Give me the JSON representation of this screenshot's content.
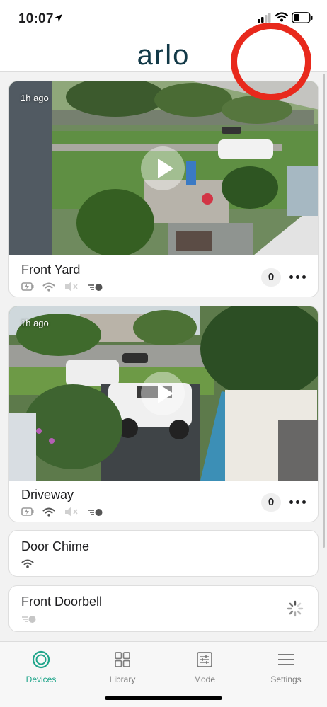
{
  "status_bar": {
    "time": "10:07",
    "location_icon": "location-arrow-icon",
    "signal_icon": "cellular-signal-icon",
    "wifi_icon": "wifi-icon",
    "battery_icon": "battery-icon"
  },
  "header": {
    "brand": "arlo",
    "brand_color": "#123947"
  },
  "annotation": {
    "color": "#e8291c"
  },
  "devices": [
    {
      "name": "Front Yard",
      "time_ago": "1h ago",
      "count": "0",
      "icons": [
        "battery-charging-icon",
        "wifi-icon",
        "speaker-muted-icon",
        "motion-toggle-icon"
      ]
    },
    {
      "name": "Driveway",
      "time_ago": "1h ago",
      "count": "0",
      "icons": [
        "battery-charging-icon",
        "wifi-icon",
        "speaker-muted-icon",
        "motion-toggle-icon"
      ]
    },
    {
      "name": "Door Chime",
      "icons": [
        "wifi-icon"
      ]
    },
    {
      "name": "Front Doorbell",
      "icons": [
        "motion-toggle-icon",
        "loading-spinner-icon"
      ]
    }
  ],
  "tabs": [
    {
      "label": "Devices",
      "icon": "devices-icon",
      "active": true
    },
    {
      "label": "Library",
      "icon": "library-grid-icon",
      "active": false
    },
    {
      "label": "Mode",
      "icon": "mode-sliders-icon",
      "active": false
    },
    {
      "label": "Settings",
      "icon": "menu-icon",
      "active": false
    }
  ],
  "colors": {
    "accent": "#1fa58a",
    "inactive_tab": "#7c7c7c"
  }
}
